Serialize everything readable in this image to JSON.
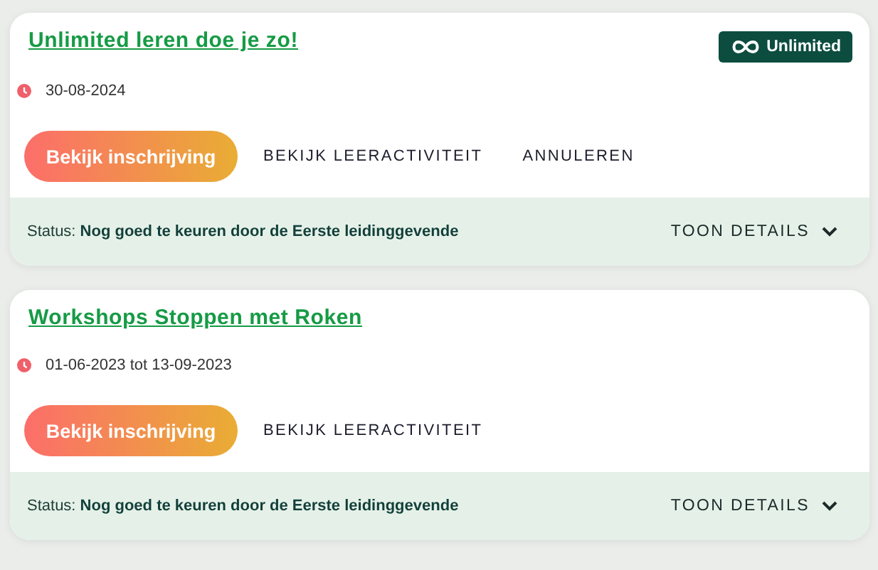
{
  "enrollments": [
    {
      "title": "Unlimited leren doe je zo!",
      "badge": "Unlimited",
      "date": "30-08-2024",
      "actions": [
        {
          "kind": "primary",
          "label": "Bekijk inschrijving"
        },
        {
          "kind": "text",
          "label": "BEKIJK LEERACTIVITEIT"
        },
        {
          "kind": "text",
          "label": "ANNULEREN"
        }
      ],
      "status": "Status: **Nog goed te keuren door de Eerste leidinggevende**",
      "details": "TOON DETAILS"
    },
    {
      "title": "Workshops Stoppen met Roken",
      "date": "01-06-2023 tot 13-09-2023",
      "actions": [
        {
          "kind": "primary",
          "label": "Bekijk inschrijving"
        },
        {
          "kind": "text",
          "label": "BEKIJK LEERACTIVITEIT"
        }
      ],
      "status": "Status: **Nog goed te keuren door de Eerste leidinggevende**",
      "details": "TOON DETAILS"
    }
  ]
}
